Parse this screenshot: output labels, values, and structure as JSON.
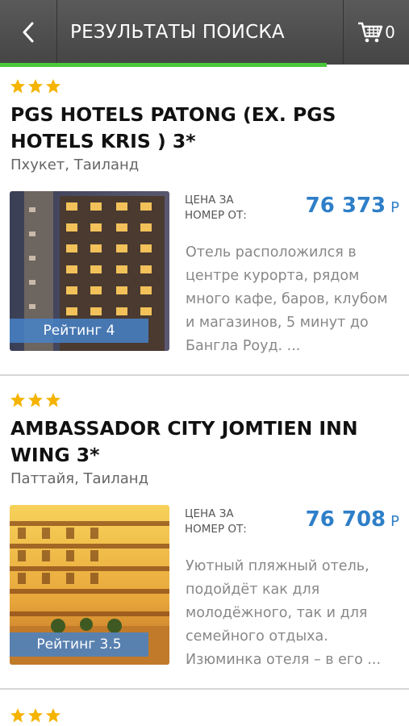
{
  "header": {
    "title": "РЕЗУЛЬТАТЫ ПОИСКА",
    "cart_count": "0",
    "back_icon": "chevron-left-icon",
    "cart_icon": "cart-icon"
  },
  "hotels": [
    {
      "stars": 3,
      "name": "PGS HOTELS PATONG (EX. PGS HOTELS KRIS ) 3*",
      "location": "Пхукет, Таиланд",
      "rating": "Рейтинг 4",
      "price_label": "ЦЕНА ЗА НОМЕР ОТ:",
      "price": "76 373",
      "currency": "Р",
      "description": "Отель расположился в центре курорта, рядом много кафе, баров, клубом и магазинов, 5 минут до Бангла Роуд. ..."
    },
    {
      "stars": 3,
      "name": "AMBASSADOR CITY JOMTIEN INN WING 3*",
      "location": "Паттайя, Таиланд",
      "rating": "Рейтинг 3.5",
      "price_label": "ЦЕНА ЗА НОМЕР ОТ:",
      "price": "76 708",
      "currency": "Р",
      "description": "Уютный пляжный отель, подойдёт как для молодёжного, так и для семейного отдыха. Изюминка отеля – в его ..."
    },
    {
      "stars": 3
    }
  ],
  "colors": {
    "header_bg": "#4e4e4e",
    "progress": "#49c83a",
    "star": "#f5b400",
    "price": "#2f7fc8",
    "rating_badge": "#4682c8"
  }
}
